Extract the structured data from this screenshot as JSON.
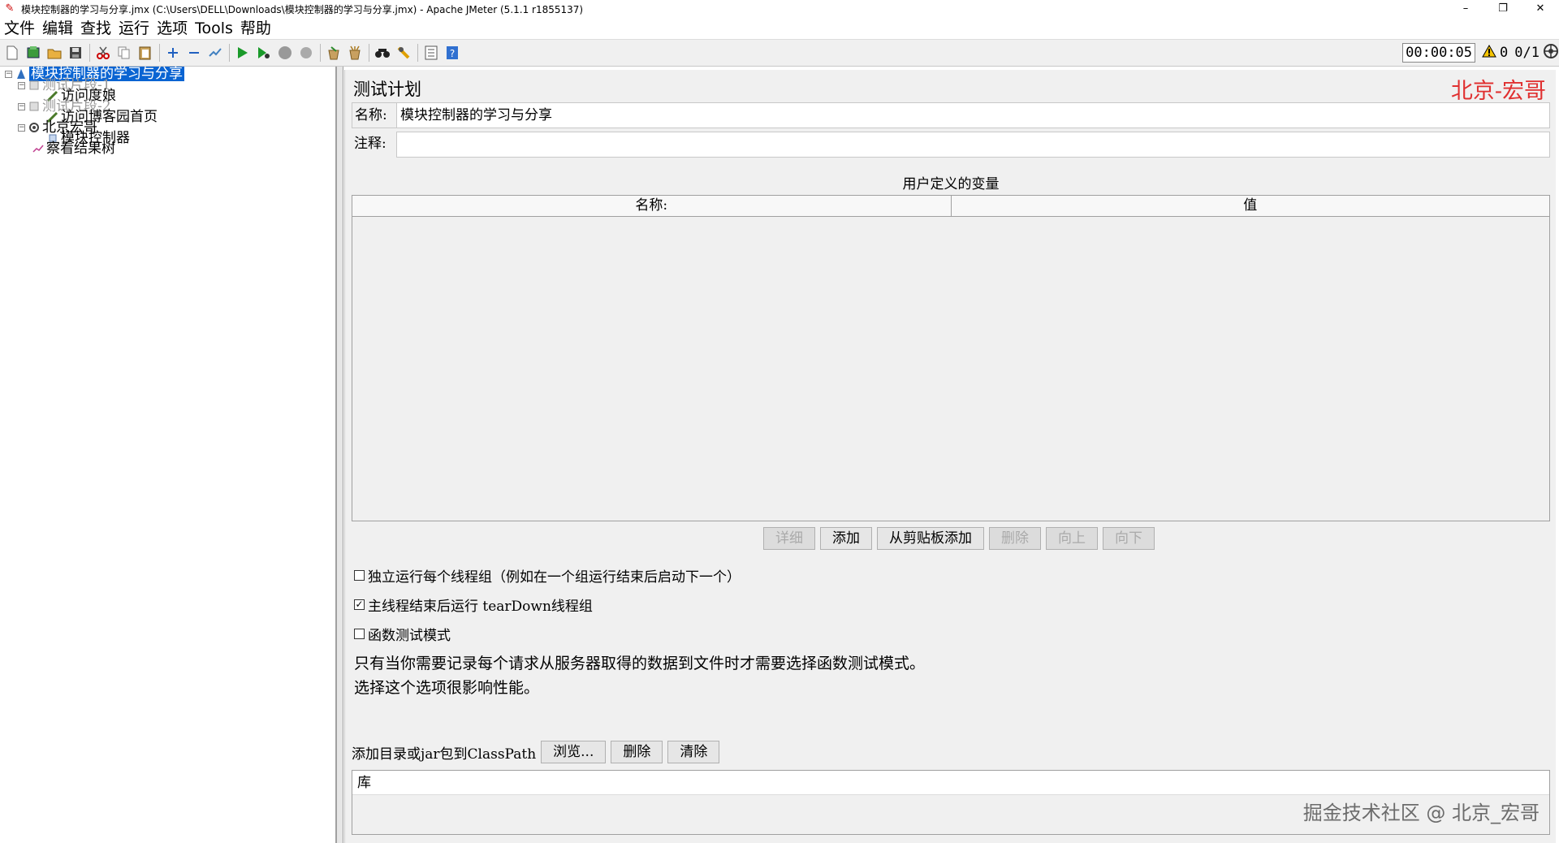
{
  "window": {
    "title": "模块控制器的学习与分享.jmx (C:\\Users\\DELL\\Downloads\\模块控制器的学习与分享.jmx) - Apache JMeter (5.1.1 r1855137)",
    "minimize": "–",
    "restore": "❐",
    "close": "✕"
  },
  "menu": [
    "文件",
    "编辑",
    "查找",
    "运行",
    "选项",
    "Tools",
    "帮助"
  ],
  "toolbar": {
    "icons": [
      "new-icon",
      "templates-icon",
      "open-icon",
      "save-icon",
      "cut-icon",
      "copy-icon",
      "paste-icon",
      "expand-icon",
      "collapse-icon",
      "toggle-icon",
      "start-icon",
      "start-no-pause-icon",
      "stop-icon",
      "shutdown-icon",
      "clear-icon",
      "clear-all-icon",
      "search-icon",
      "reset-search-icon",
      "function-helper-icon",
      "help-icon"
    ],
    "timer": "00:00:05",
    "warning_count": "0",
    "threads": "0/1"
  },
  "tree": {
    "root": "模块控制器的学习与分享",
    "items": [
      {
        "label": "测试片段-1",
        "dim": true
      },
      {
        "label": "访问度娘"
      },
      {
        "label": "测试片段-2",
        "dim": true
      },
      {
        "label": "访问博客园首页"
      },
      {
        "label": "北京宏哥"
      },
      {
        "label": "模块控制器"
      },
      {
        "label": "察看结果树"
      }
    ]
  },
  "panel": {
    "title": "测试计划",
    "brand": "北京-宏哥",
    "name_label": "名称:",
    "name_value": "模块控制器的学习与分享",
    "comment_label": "注释:",
    "comment_value": "",
    "vars_title": "用户定义的变量",
    "table_headers": [
      "名称:",
      "值"
    ],
    "buttons": [
      "详细",
      "添加",
      "从剪贴板添加",
      "删除",
      "向上",
      "向下"
    ],
    "options": [
      {
        "label": "独立运行每个线程组（例如在一个组运行结束后启动下一个）",
        "checked": false
      },
      {
        "label": "主线程结束后运行 tearDown线程组",
        "checked": true
      },
      {
        "label": "函数测试模式",
        "checked": false
      }
    ],
    "note_line1": "只有当你需要记录每个请求从服务器取得的数据到文件时才需要选择函数测试模式。",
    "note_line2": "选择这个选项很影响性能。",
    "classpath_label": "添加目录或jar包到ClassPath",
    "classpath_buttons": [
      "浏览...",
      "删除",
      "清除"
    ],
    "lib_header": "库",
    "footer_watermark": "掘金技术社区 @ 北京_宏哥"
  }
}
